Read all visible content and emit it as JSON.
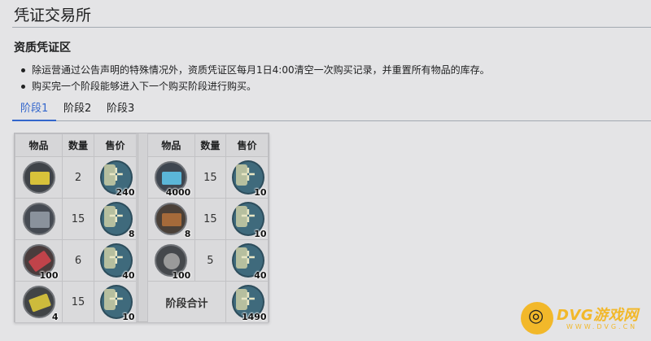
{
  "page": {
    "title": "凭证交易所"
  },
  "section": {
    "title": "资质凭证区",
    "notes": [
      "除运营通过公告声明的特殊情况外，资质凭证区每月1日4:00清空一次购买记录，并重置所有物品的库存。",
      "购买完一个阶段能够进入下一个购买阶段进行购买。"
    ]
  },
  "tabs": [
    {
      "label": "阶段1",
      "active": true
    },
    {
      "label": "阶段2",
      "active": false
    },
    {
      "label": "阶段3",
      "active": false
    }
  ],
  "shop": {
    "headers": {
      "item": "物品",
      "qty": "数量",
      "price": "售价"
    },
    "left": [
      {
        "icon": "yellow-device-icon",
        "item_count": "",
        "qty": "2",
        "price": "240"
      },
      {
        "icon": "grey-box-icon",
        "item_count": "",
        "qty": "15",
        "price": "8"
      },
      {
        "icon": "red-material-icon",
        "item_count": "100",
        "qty": "6",
        "price": "40"
      },
      {
        "icon": "yellow-chip-icon",
        "item_count": "4",
        "qty": "15",
        "price": "10"
      }
    ],
    "right": [
      {
        "icon": "blue-crystal-icon",
        "item_count": "4000",
        "qty": "15",
        "price": "10"
      },
      {
        "icon": "brown-alloy-icon",
        "item_count": "8",
        "qty": "15",
        "price": "10"
      },
      {
        "icon": "grey-ore-icon",
        "item_count": "100",
        "qty": "5",
        "price": "40"
      }
    ],
    "total": {
      "label": "阶段合计",
      "price": "1490"
    }
  },
  "watermark": {
    "text": "DVG游戏网",
    "sub": "WWW.DVG.CN"
  }
}
